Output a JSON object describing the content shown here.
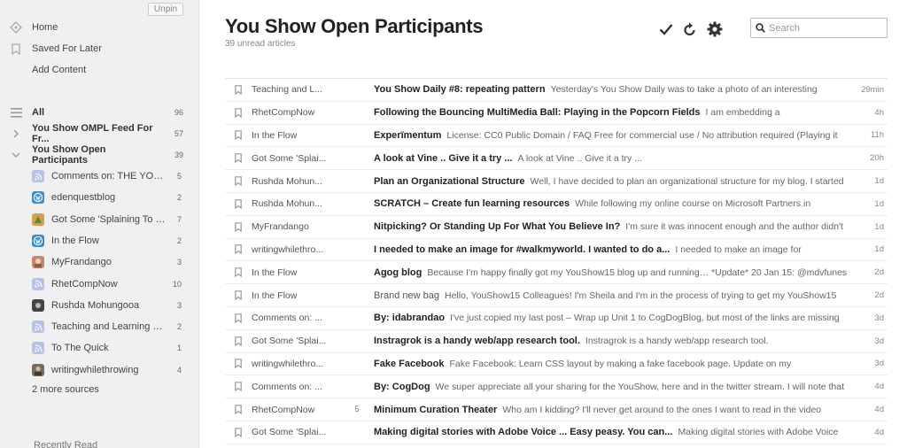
{
  "sidebar": {
    "unpin_label": "Unpin",
    "nav": [
      {
        "label": "Home",
        "icon": "home-icon"
      },
      {
        "label": "Saved For Later",
        "icon": "bookmark-icon"
      },
      {
        "label": "Add Content",
        "icon": ""
      }
    ],
    "all": {
      "label": "All",
      "count": "96"
    },
    "feeds": [
      {
        "label": "You Show OMPL Feed For Fr...",
        "count": "57",
        "state": "collapsed"
      },
      {
        "label": "You Show Open Participants",
        "count": "39",
        "state": "expanded"
      }
    ],
    "sources": [
      {
        "label": "Comments on: THE YOU S...",
        "count": "5",
        "icon": "rss-icon",
        "color": "#b8c2e8"
      },
      {
        "label": "edenquestblog",
        "count": "2",
        "icon": "wordpress-icon",
        "color": "#3a8fd6"
      },
      {
        "label": "Got Some 'Splaining To Do",
        "count": "7",
        "icon": "blog-avatar-icon",
        "color": "#d0a24a"
      },
      {
        "label": "In the Flow",
        "count": "2",
        "icon": "wordpress-icon",
        "color": "#3a8fd6"
      },
      {
        "label": "MyFrandango",
        "count": "3",
        "icon": "photo-avatar-icon",
        "color": "#c9866a"
      },
      {
        "label": "RhetCompNow",
        "count": "10",
        "icon": "rss-icon",
        "color": "#b8c2e8"
      },
      {
        "label": "Rushda Mohungooa",
        "count": "3",
        "icon": "dark-square-icon",
        "color": "#444444"
      },
      {
        "label": "Teaching and Learning Portf...",
        "count": "2",
        "icon": "rss-icon",
        "color": "#b8c2e8"
      },
      {
        "label": "To The Quick",
        "count": "1",
        "icon": "rss-icon",
        "color": "#b8c2e8"
      },
      {
        "label": "writingwhilethrowing",
        "count": "4",
        "icon": "person-avatar-icon",
        "color": "#7a6a5a"
      }
    ],
    "more_sources": "2 more sources",
    "recently_read": "Recently Read"
  },
  "main": {
    "title": "You Show Open Participants",
    "unread": "39 unread articles",
    "search_placeholder": "Search",
    "articles": [
      {
        "source": "Teaching and L...",
        "count": "",
        "title": "You Show Daily #8: repeating pattern",
        "snippet": "Yesterday's You Show Daily was to take a photo of an interesting",
        "age": "29min",
        "read": false
      },
      {
        "source": "RhetCompNow",
        "count": "",
        "title": "Following the Bouncing MultiMedia Ball: Playing in the Popcorn Fields",
        "snippet": "I am embedding a",
        "age": "4h",
        "read": false
      },
      {
        "source": "In the Flow",
        "count": "",
        "title": "Experïmentum",
        "snippet": "License: CC0 Public Domain / FAQ Free for commercial use / No attribution required (Playing it",
        "age": "11h",
        "read": false
      },
      {
        "source": "Got Some 'Splai...",
        "count": "",
        "title": "A look at Vine .. Give it a try ...",
        "snippet": "A look at Vine .. Give it a try ...",
        "age": "20h",
        "read": false
      },
      {
        "source": "Rushda Mohun...",
        "count": "",
        "title": "Plan an Organizational Structure",
        "snippet": "Well, I have decided to plan an organizational structure for my blog.  I started",
        "age": "1d",
        "read": false
      },
      {
        "source": "Rushda Mohun...",
        "count": "",
        "title": "SCRATCH – Create fun learning resources",
        "snippet": "While following my online course on Microsoft Partners in",
        "age": "1d",
        "read": false
      },
      {
        "source": "MyFrandango",
        "count": "",
        "title": "Nitpicking? Or Standing Up For What You Believe In?",
        "snippet": "I'm sure it was innocent enough and the author didn't",
        "age": "1d",
        "read": false
      },
      {
        "source": "writingwhilethro...",
        "count": "",
        "title": "I needed to make an image for #walkmyworld. I wanted to do a...",
        "snippet": "I needed to make an image for",
        "age": "1d",
        "read": false
      },
      {
        "source": "In the Flow",
        "count": "",
        "title": "Agog blog",
        "snippet": "Because I'm happy finally got my YouShow15 blog up and running… *Update* 20 Jan 15: @mdvfunes",
        "age": "2d",
        "read": false
      },
      {
        "source": "In the Flow",
        "count": "",
        "title": "Brand new bag",
        "snippet": "Hello, YouShow15 Colleagues! I'm Sheila and I'm in the process of trying to get my YouShow15",
        "age": "2d",
        "read": true
      },
      {
        "source": "Comments on: ...",
        "count": "",
        "title": "By: idabrandao",
        "snippet": "I've just copied my last post – Wrap up Unit 1 to CogDogBlog, but most of the links are missing",
        "age": "3d",
        "read": false
      },
      {
        "source": "Got Some 'Splai...",
        "count": "",
        "title": "Instragrok is a handy web/app research tool.",
        "snippet": "Instragrok is a handy web/app research tool.",
        "age": "3d",
        "read": false
      },
      {
        "source": "writingwhilethro...",
        "count": "",
        "title": "Fake Facebook",
        "snippet": "Fake Facebook: Learn CSS layout by making a fake facebook page. Update on my",
        "age": "3d",
        "read": false
      },
      {
        "source": "Comments on: ...",
        "count": "",
        "title": "By: CogDog",
        "snippet": "We super appreciate all your sharing for the YouShow, here and in the twitter stream. I will note that",
        "age": "4d",
        "read": false
      },
      {
        "source": "RhetCompNow",
        "count": "5",
        "title": "Minimum Curation Theater",
        "snippet": "Who am I kidding? I'll never get around to the ones I want to read in the video",
        "age": "4d",
        "read": false
      },
      {
        "source": "Got Some 'Splai...",
        "count": "",
        "title": "Making digital stories with Adobe Voice ... Easy peasy. You can...",
        "snippet": "Making digital stories with Adobe Voice",
        "age": "4d",
        "read": false
      }
    ]
  }
}
